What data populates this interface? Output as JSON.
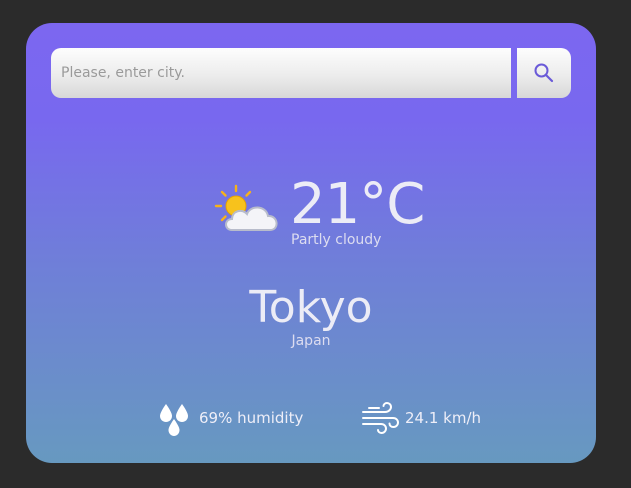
{
  "search": {
    "placeholder": "Please, enter city.",
    "value": "",
    "button_icon": "search-icon"
  },
  "weather": {
    "icon": "partly-cloudy-icon",
    "temperature": "21°C",
    "condition": "Partly cloudy"
  },
  "location": {
    "city": "Tokyo",
    "country": "Japan"
  },
  "details": {
    "humidity_icon": "humidity-drops-icon",
    "humidity_text": "69% humidity",
    "wind_icon": "wind-icon",
    "wind_text": "24.1 km/h"
  },
  "colors": {
    "page_background": "#2b2b2b",
    "card_gradient_top": "#7c67f0",
    "card_gradient_bottom": "#6799c0",
    "search_icon": "#6a5ad8"
  }
}
